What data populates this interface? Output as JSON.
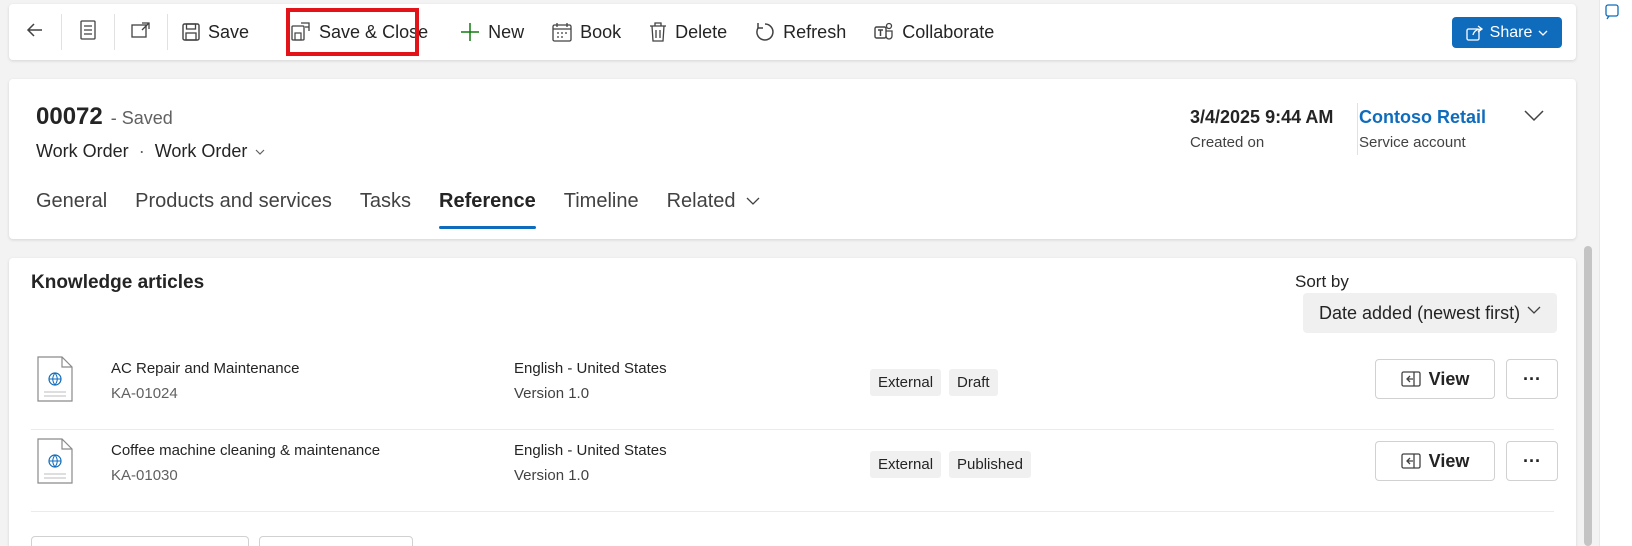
{
  "toolbar": {
    "back_icon": "arrow-left-icon",
    "form_icon": "form-icon",
    "popout_icon": "open-in-new-window-icon",
    "save_label": "Save",
    "save_close_label": "Save & Close",
    "new_label": "New",
    "book_label": "Book",
    "delete_label": "Delete",
    "refresh_label": "Refresh",
    "collaborate_label": "Collaborate",
    "share_label": "Share",
    "highlight_color": "#e2141a",
    "accent_color": "#0f6cbd"
  },
  "header": {
    "record_id": "00072",
    "record_status": "- Saved",
    "entity": "Work Order",
    "dot": "·",
    "form_name": "Work Order",
    "created_value": "3/4/2025 9:44 AM",
    "created_label": "Created on",
    "account_value": "Contoso Retail",
    "account_label": "Service account"
  },
  "tabs": [
    {
      "label": "General"
    },
    {
      "label": "Products and services"
    },
    {
      "label": "Tasks"
    },
    {
      "label": "Reference",
      "active": true
    },
    {
      "label": "Timeline"
    },
    {
      "label": "Related"
    }
  ],
  "knowledge": {
    "title": "Knowledge articles",
    "sort_label": "Sort by",
    "sort_value": "Date added (newest first)",
    "view_label": "View",
    "more_label": "···",
    "articles": [
      {
        "name": "AC Repair and Maintenance",
        "number": "KA-01024",
        "language": "English - United States",
        "version": "Version 1.0",
        "tags": [
          "External",
          "Draft"
        ]
      },
      {
        "name": "Coffee machine cleaning & maintenance",
        "number": "KA-01030",
        "language": "English - United States",
        "version": "Version 1.0",
        "tags": [
          "External",
          "Published"
        ]
      }
    ]
  }
}
